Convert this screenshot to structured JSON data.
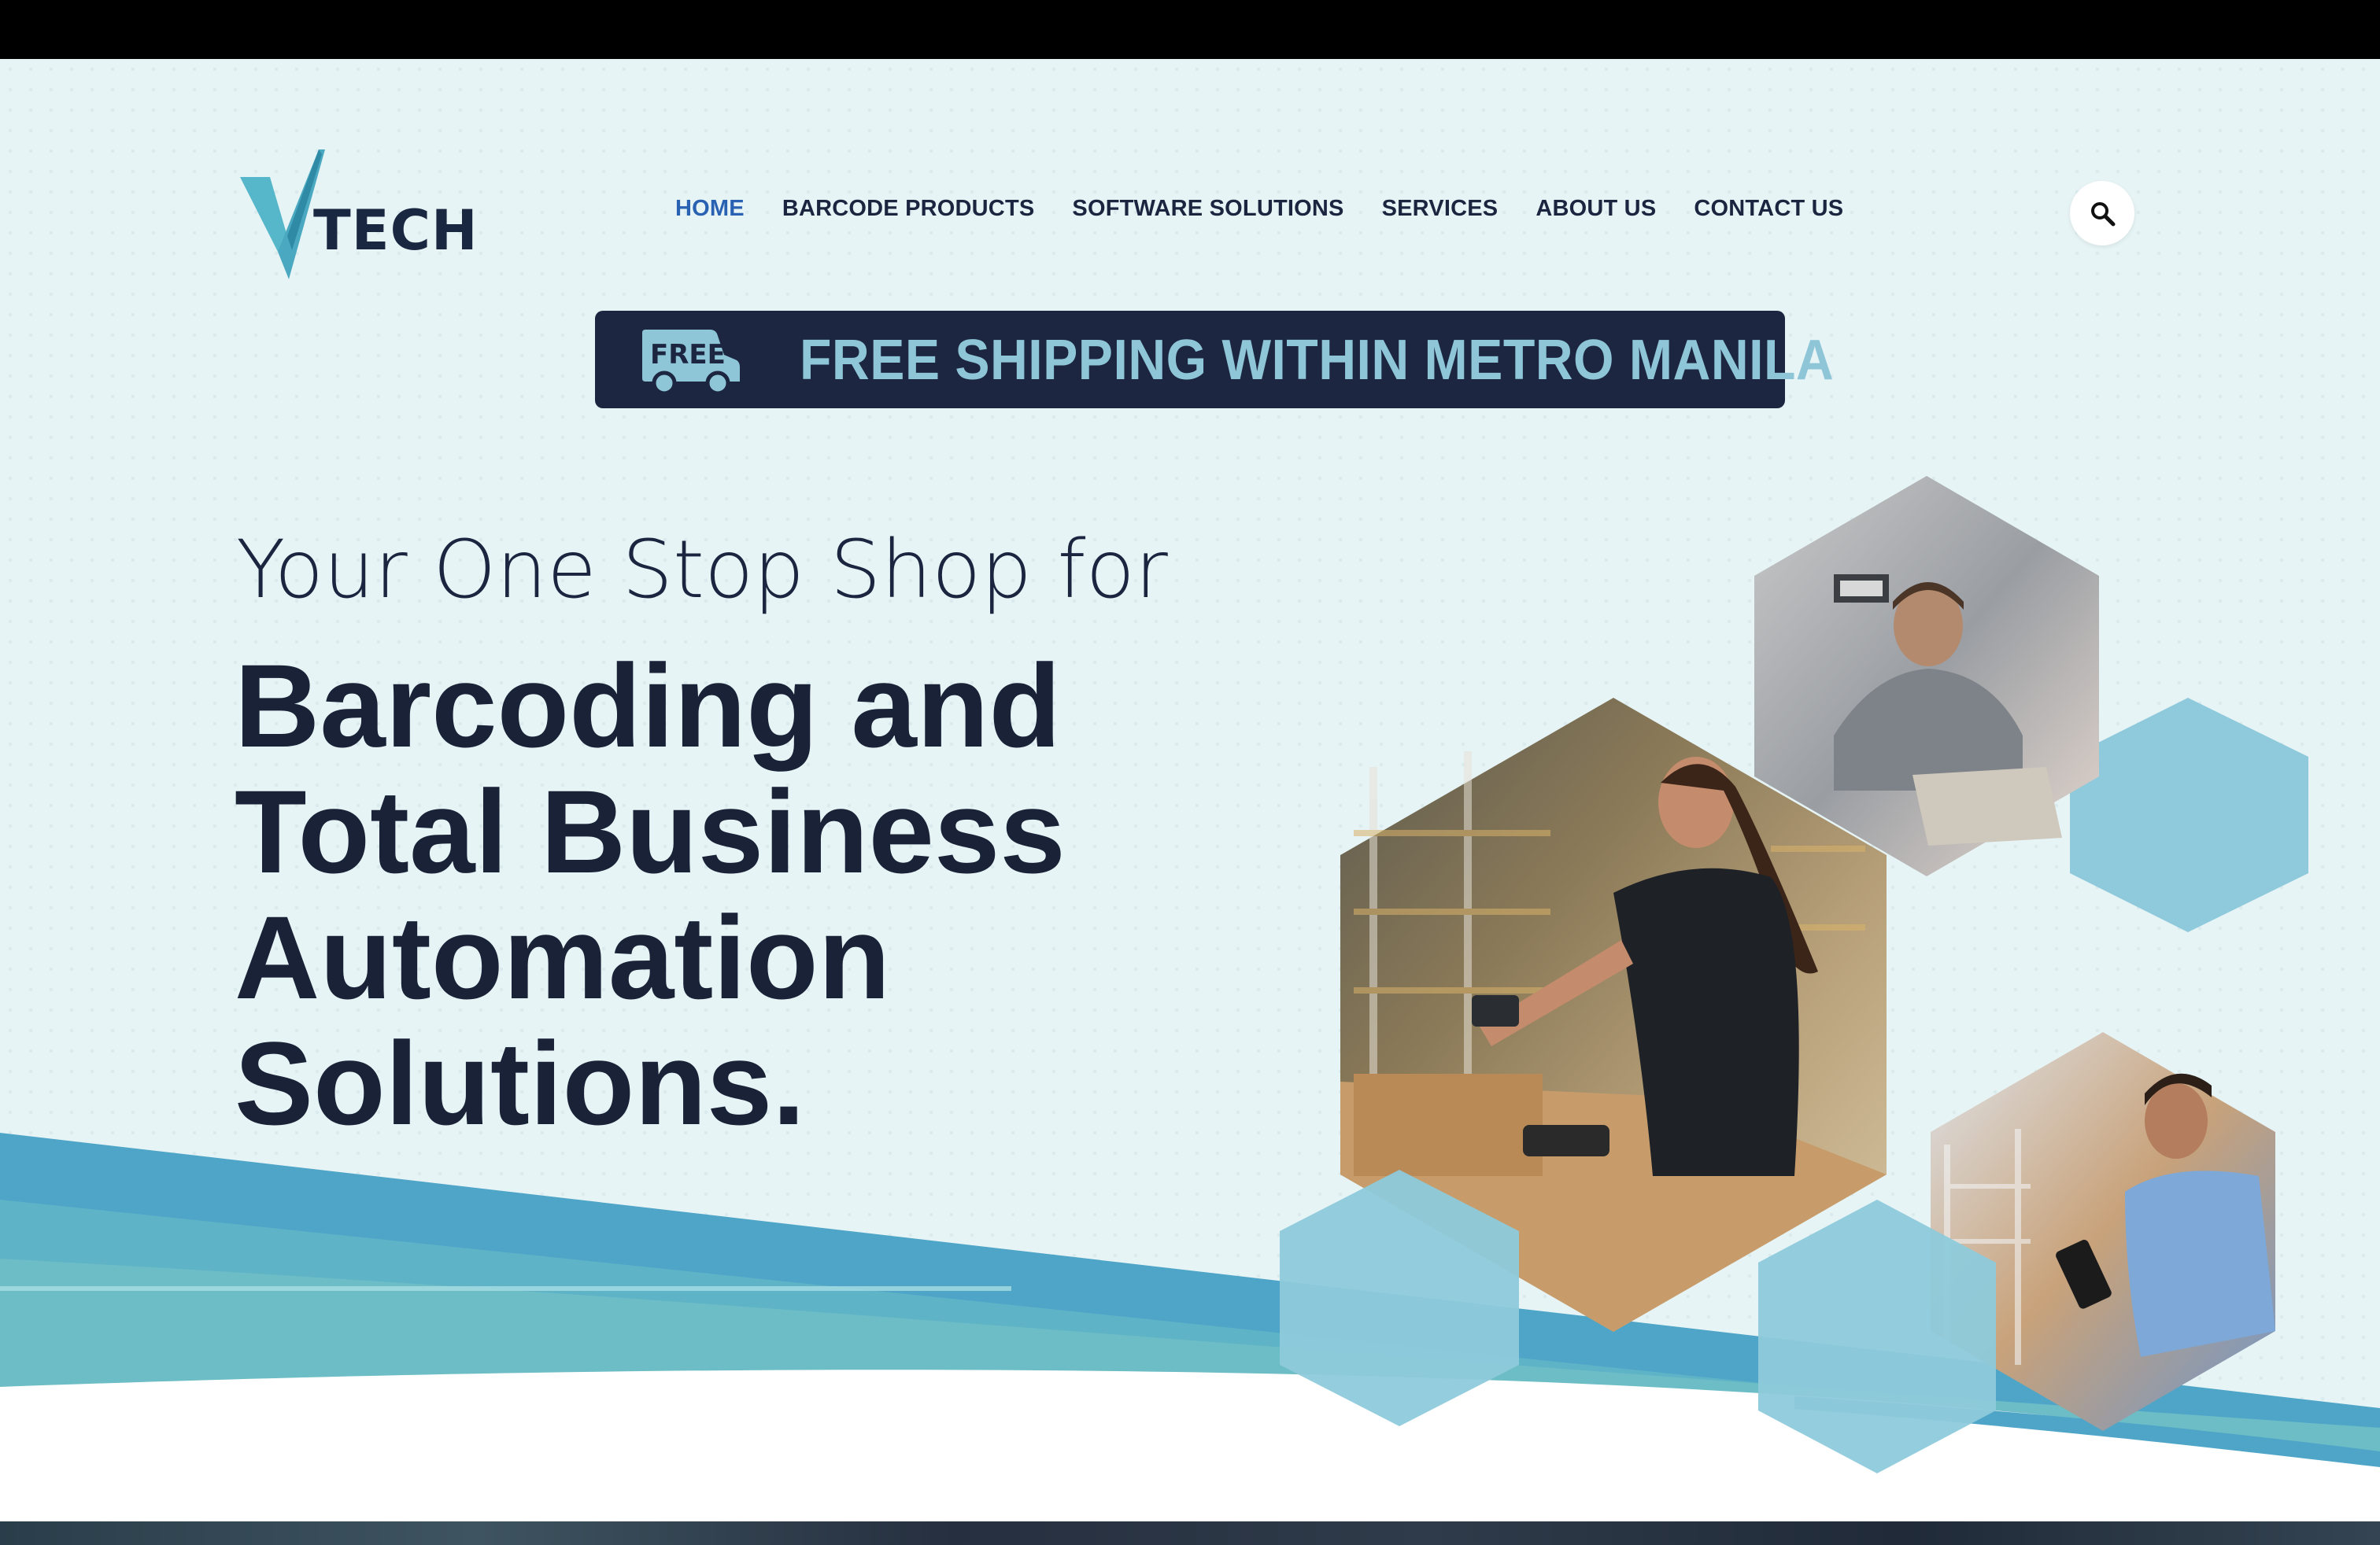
{
  "brand": {
    "logo_text": "TECH",
    "logo_letter": "V"
  },
  "nav": {
    "items": [
      {
        "label": "HOME",
        "active": true
      },
      {
        "label": "BARCODE PRODUCTS",
        "active": false
      },
      {
        "label": "SOFTWARE SOLUTIONS",
        "active": false
      },
      {
        "label": "SERVICES",
        "active": false
      },
      {
        "label": "ABOUT US",
        "active": false
      },
      {
        "label": "CONTACT US",
        "active": false
      }
    ],
    "search_icon": "search-icon"
  },
  "promo": {
    "badge_text": "FREE",
    "badge_icon": "delivery-truck-icon",
    "text": "FREE SHIPPING WITHIN METRO MANILA"
  },
  "hero": {
    "tagline": "Your One Stop Shop for",
    "headline_lines": [
      "Barcoding and",
      "Total Business",
      "Automation",
      "Solutions."
    ]
  },
  "images": [
    {
      "name": "warehouse-scanner-photo",
      "description": "woman scanning package"
    },
    {
      "name": "laptop-worker-photo",
      "description": "man working on laptop"
    },
    {
      "name": "medical-scanner-photo",
      "description": "clinician scanning supplies"
    }
  ],
  "colors": {
    "background": "#e7f4f5",
    "navy": "#1c2640",
    "accent_blue": "#2a62b3",
    "banner_text": "#8ec6d8",
    "hex_light": "#8ecadb",
    "wave_blue": "#4ea5c8",
    "wave_teal": "#6cbcc5"
  }
}
